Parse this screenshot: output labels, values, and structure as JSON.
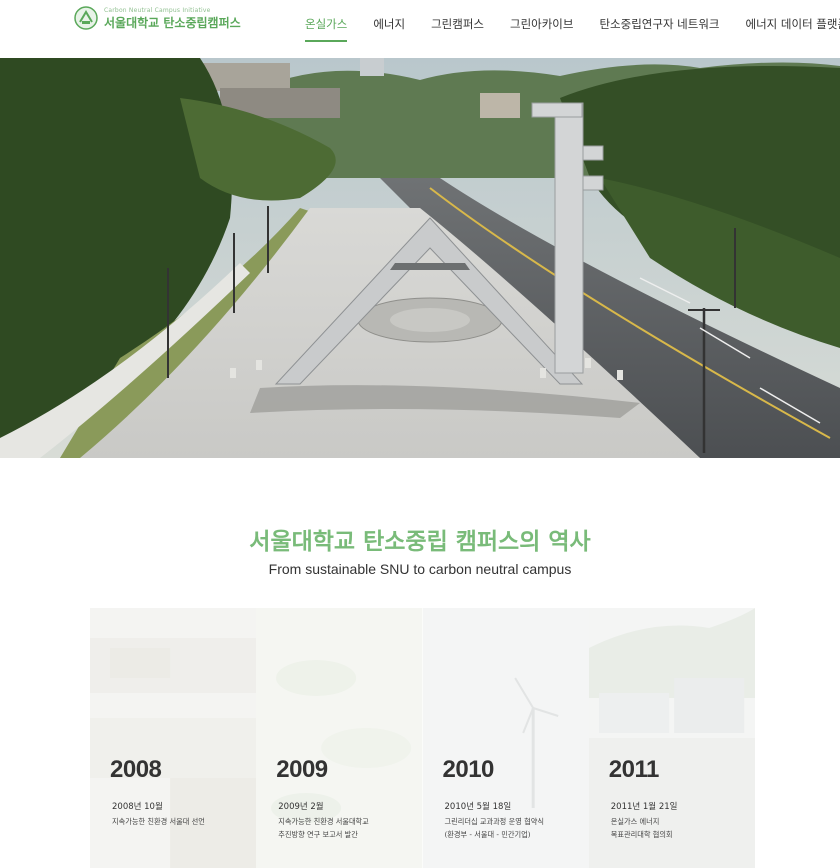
{
  "header": {
    "logo_sub": "Carbon Neutral Campus Initiative",
    "logo_main": "서울대학교 탄소중립캠퍼스",
    "logo_icon": "snu-emblem-icon",
    "brand_color": "#5aa85a",
    "nav": [
      {
        "label": "온실가스",
        "active": true
      },
      {
        "label": "에너지",
        "active": false
      },
      {
        "label": "그린캠퍼스",
        "active": false
      },
      {
        "label": "그린아카이브",
        "active": false
      },
      {
        "label": "탄소중립연구자 네트워크",
        "active": false
      },
      {
        "label": "에너지 데이터 플랫폼",
        "active": false
      }
    ]
  },
  "hero": {
    "description_icon": "snu-main-gate-photo"
  },
  "history": {
    "title": "서울대학교 탄소중립 캠퍼스의 역사",
    "subtitle": "From sustainable SNU to carbon neutral campus",
    "title_color": "#79bb79",
    "cards": [
      {
        "year": "2008",
        "date": "2008년 10월",
        "desc": [
          "지속가능한 친환경 서울대 선언"
        ]
      },
      {
        "year": "2009",
        "date": "2009년 2월",
        "desc": [
          "지속가능한 친환경 서울대학교",
          "추진방향 연구 보고서 발간"
        ]
      },
      {
        "year": "2010",
        "date": "2010년 5월 18일",
        "desc": [
          "그린리더십 교과과정 운영 협약식",
          "(환경부 - 서울대 - 민간기업)"
        ]
      },
      {
        "year": "2011",
        "date": "2011년 1월 21일",
        "desc": [
          "온실가스 에너지",
          "목표관리대학 협의회"
        ]
      }
    ]
  }
}
